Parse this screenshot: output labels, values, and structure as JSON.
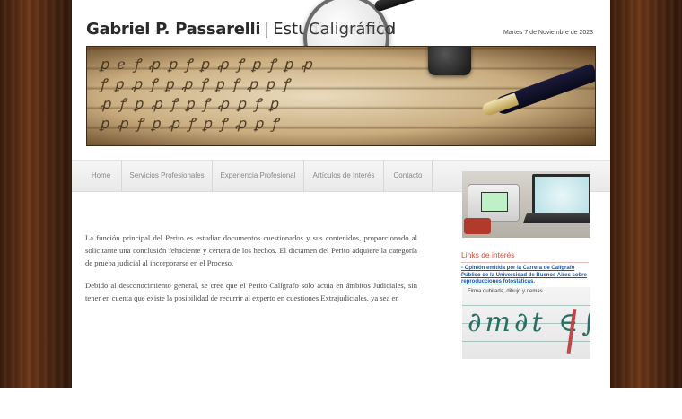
{
  "header": {
    "name": "Gabriel P. Passarelli",
    "separator": "|",
    "studio": "Estudio Pericial",
    "magnifier_label": "Caligráfico",
    "date": "Martes 7 de Noviembre de 2023"
  },
  "nav": {
    "items": [
      {
        "label": "Home"
      },
      {
        "label": "Servicios Profesionales"
      },
      {
        "label": "Experiencia Profesional"
      },
      {
        "label": "Artículos de Interés"
      },
      {
        "label": "Contacto"
      }
    ]
  },
  "content": {
    "paragraph1": "La función principal del Perito es estudiar documentos cuestionados y sus contenidos, proporcionado al solicitante una conclusión fehaciente y certera de los hechos. El dictamen del Perito adquiere la categoría de prueba judicial al incorporarse en el Proceso.",
    "paragraph2": "Debido al desconocimiento general, se cree que el Perito Calígrafo solo actúa en ámbitos Judiciales, sin tener en cuenta que existe la posibilidad de recurrir al experto en cuestiones Extrajudiciales, ya sea en"
  },
  "sidebar": {
    "links_title": "Links de interés",
    "link1": "- Opinión emitida por la Carrera de Calígrafo Público de la Universidad de Buenos Aires sobre reproducciones fotostáticas.",
    "signature_caption": "Firma dubitada, dibujo y demas"
  },
  "colors": {
    "wood": "#5a2d12",
    "links_title": "#d24a3a",
    "link": "#1c55a8",
    "nav_bg": "#eeeeee"
  }
}
